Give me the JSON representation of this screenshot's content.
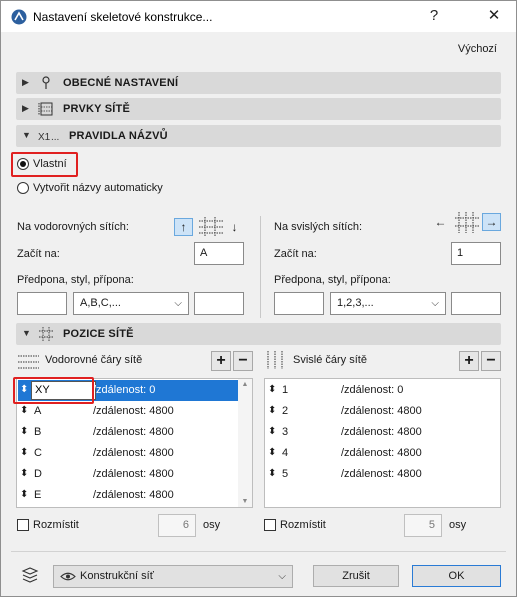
{
  "window": {
    "title": "Nastavení skeletové konstrukce...",
    "help_label": "?",
    "close_label": "✕"
  },
  "header": {
    "defaults_link": "Výchozí"
  },
  "sections": {
    "general": "OBECNÉ NASTAVENÍ",
    "grid_elements": "PRVKY SÍTĚ",
    "naming_rules": "PRAVIDLA NÁZVŮ",
    "grid_positions": "POZICE SÍTĚ"
  },
  "naming": {
    "radio_custom": "Vlastní",
    "radio_auto": "Vytvořit názvy automaticky",
    "selected": "custom",
    "horizontal": {
      "label": "Na vodorovných sítích:",
      "start_label": "Začít na:",
      "start_value": "A",
      "prefix_label": "Předpona, styl, přípona:",
      "prefix_value": "",
      "style_value": "A,B,C,...",
      "suffix_value": "",
      "dir_up": "↑",
      "dir_down": "↓"
    },
    "vertical": {
      "label": "Na svislých sítích:",
      "start_label": "Začít na:",
      "start_value": "1",
      "prefix_label": "Předpona, styl, přípona:",
      "prefix_value": "",
      "style_value": "1,2,3,...",
      "suffix_value": "",
      "dir_left": "←",
      "dir_right": "→"
    }
  },
  "positions": {
    "horizontal": {
      "label": "Vodorovné čáry sítě",
      "add": "+",
      "remove": "−",
      "rows": [
        {
          "name": "XY",
          "dist": "/zdálenost: 0"
        },
        {
          "name": "A",
          "dist": "/zdálenost: 4800"
        },
        {
          "name": "B",
          "dist": "/zdálenost: 4800"
        },
        {
          "name": "C",
          "dist": "/zdálenost: 4800"
        },
        {
          "name": "D",
          "dist": "/zdálenost: 4800"
        },
        {
          "name": "E",
          "dist": "/zdálenost: 4800"
        }
      ],
      "distribute_label": "Rozmístit",
      "axes_count": "6",
      "axes_label": "osy"
    },
    "vertical": {
      "label": "Svislé čáry sítě",
      "add": "+",
      "remove": "−",
      "rows": [
        {
          "name": "1",
          "dist": "/zdálenost: 0"
        },
        {
          "name": "2",
          "dist": "/zdálenost: 4800"
        },
        {
          "name": "3",
          "dist": "/zdálenost: 4800"
        },
        {
          "name": "4",
          "dist": "/zdálenost: 4800"
        },
        {
          "name": "5",
          "dist": "/zdálenost: 4800"
        }
      ],
      "distribute_label": "Rozmístit",
      "axes_count": "5",
      "axes_label": "osy"
    }
  },
  "footer": {
    "layer_select": "Konstrukční síť",
    "cancel": "Zrušit",
    "ok": "OK"
  },
  "colors": {
    "selection": "#1f77d4",
    "highlight_box": "#e02020",
    "section_bg": "#d9d9d9"
  }
}
